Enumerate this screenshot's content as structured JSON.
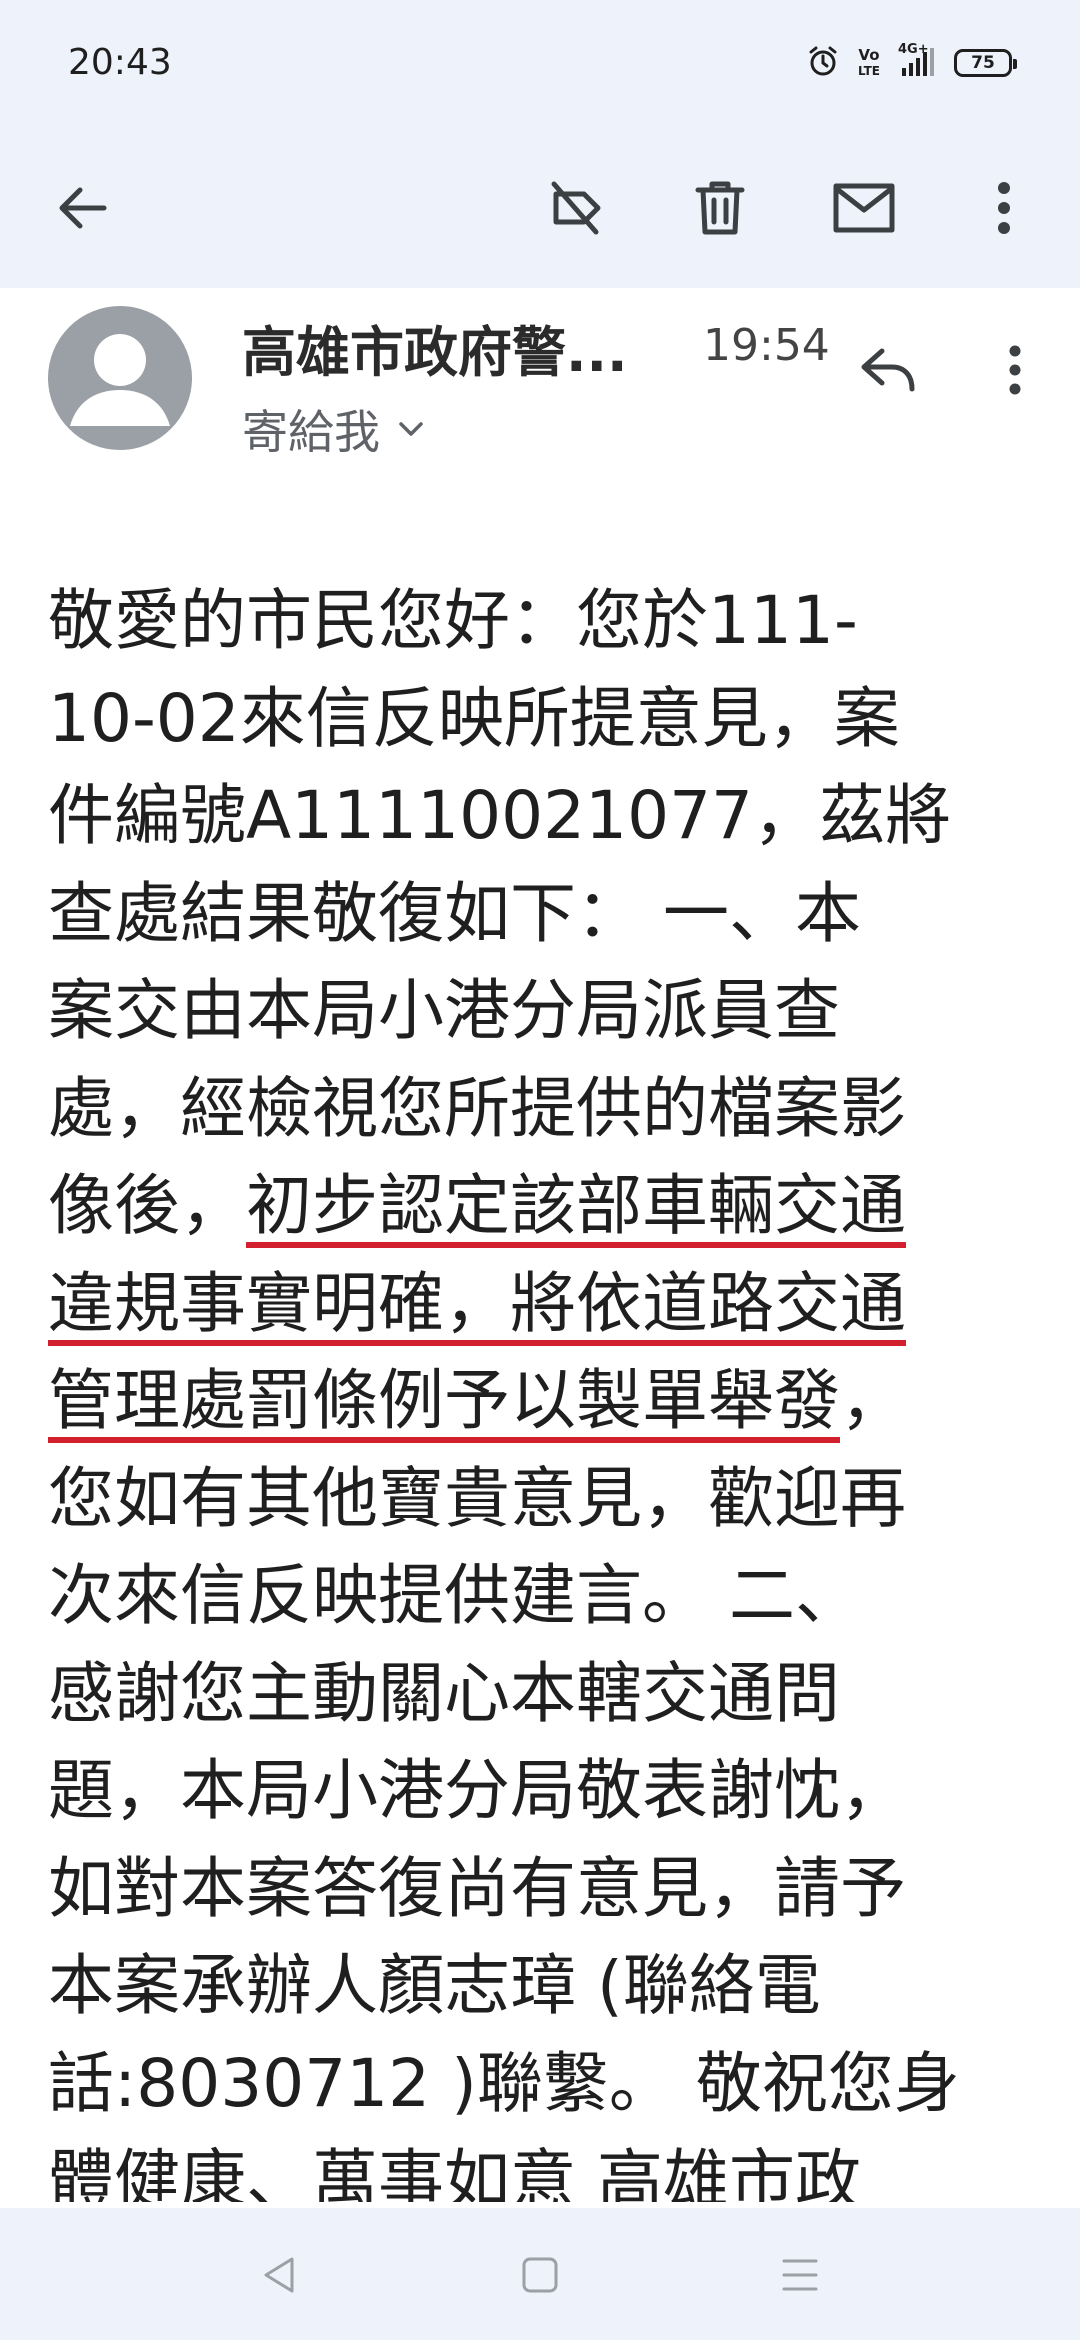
{
  "status": {
    "time": "20:43",
    "volte_top": "Vo",
    "volte_bottom": "LTE",
    "network": "4G+",
    "battery": "75"
  },
  "email": {
    "sender": "高雄市政府警...",
    "time": "19:54",
    "recipient": "寄給我",
    "body_lines": [
      "敬愛的市民您好：您於111-",
      "10-02來信反映所提意見，案",
      "件編號A11110021077，茲將",
      "查處結果敬復如下： 一、本",
      "案交由本局小港分局派員查",
      "處，經檢視您所提供的檔案影",
      "像後，",
      "初步認定該部車輛交通",
      "違規事實明確，將依道路交通",
      "管理處罰條例予以製單舉發",
      "，",
      "您如有其他寶貴意見，歡迎再",
      "次來信反映提供建言。 二、",
      "感謝您主動關心本轄交通問",
      "題，本局小港分局敬表謝忱，",
      "如對本案答復尚有意見，請予",
      "本案承辦人顏志璋 (聯絡電",
      "話:8030712 )聯繫。 敬祝您身",
      "體健康、萬事如意 高雄市政"
    ]
  }
}
